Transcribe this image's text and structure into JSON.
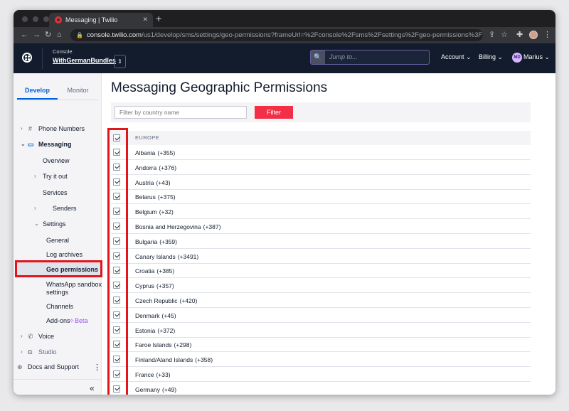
{
  "browser": {
    "tab_title": "Messaging | Twilio",
    "url_host": "console.twilio.com",
    "url_path": "/us1/develop/sms/settings/geo-permissions?frameUrl=%2Fconsole%2Fsms%2Fsettings%2Fgeo-permissions%3Fx-target-region..."
  },
  "header": {
    "console_label": "Console",
    "account_name": "WithGermanBundles",
    "search_placeholder": "Jump to...",
    "account_menu": "Account",
    "billing_menu": "Billing",
    "user_initials": "MD",
    "user_name": "Marius"
  },
  "sidebar": {
    "tabs": [
      "Develop",
      "Monitor"
    ],
    "items": {
      "phone_numbers": "Phone Numbers",
      "messaging": "Messaging",
      "overview": "Overview",
      "try_it_out": "Try it out",
      "services": "Services",
      "senders": "Senders",
      "settings": "Settings",
      "general": "General",
      "log_archives": "Log archives",
      "geo_permissions": "Geo permissions",
      "whatsapp_line1": "WhatsApp sandbox",
      "whatsapp_line2": "settings",
      "channels": "Channels",
      "addons": "Add-ons",
      "beta": "Beta",
      "voice": "Voice",
      "studio": "Studio",
      "docs": "Docs and Support"
    }
  },
  "main": {
    "title": "Messaging Geographic Permissions",
    "filter_placeholder": "Filter by country name",
    "filter_button": "Filter",
    "region": "EUROPE",
    "countries": [
      {
        "name": "Albania",
        "code": "(+355)"
      },
      {
        "name": "Andorra",
        "code": "(+376)"
      },
      {
        "name": "Austria",
        "code": "(+43)"
      },
      {
        "name": "Belarus",
        "code": "(+375)"
      },
      {
        "name": "Belgium",
        "code": "(+32)"
      },
      {
        "name": "Bosnia and Herzegovina",
        "code": "(+387)"
      },
      {
        "name": "Bulgaria",
        "code": "(+359)"
      },
      {
        "name": "Canary Islands",
        "code": "(+3491)"
      },
      {
        "name": "Croatia",
        "code": "(+385)"
      },
      {
        "name": "Cyprus",
        "code": "(+357)"
      },
      {
        "name": "Czech Republic",
        "code": "(+420)"
      },
      {
        "name": "Denmark",
        "code": "(+45)"
      },
      {
        "name": "Estonia",
        "code": "(+372)"
      },
      {
        "name": "Faroe Islands",
        "code": "(+298)"
      },
      {
        "name": "Finland/Aland Islands",
        "code": "(+358)"
      },
      {
        "name": "France",
        "code": "(+33)"
      },
      {
        "name": "Germany",
        "code": "(+49)"
      }
    ]
  },
  "colors": {
    "header_bg": "#121c2d",
    "filter_button": "#f22f46",
    "highlight_box": "#e3141c",
    "active_tab": "#0263e0"
  }
}
